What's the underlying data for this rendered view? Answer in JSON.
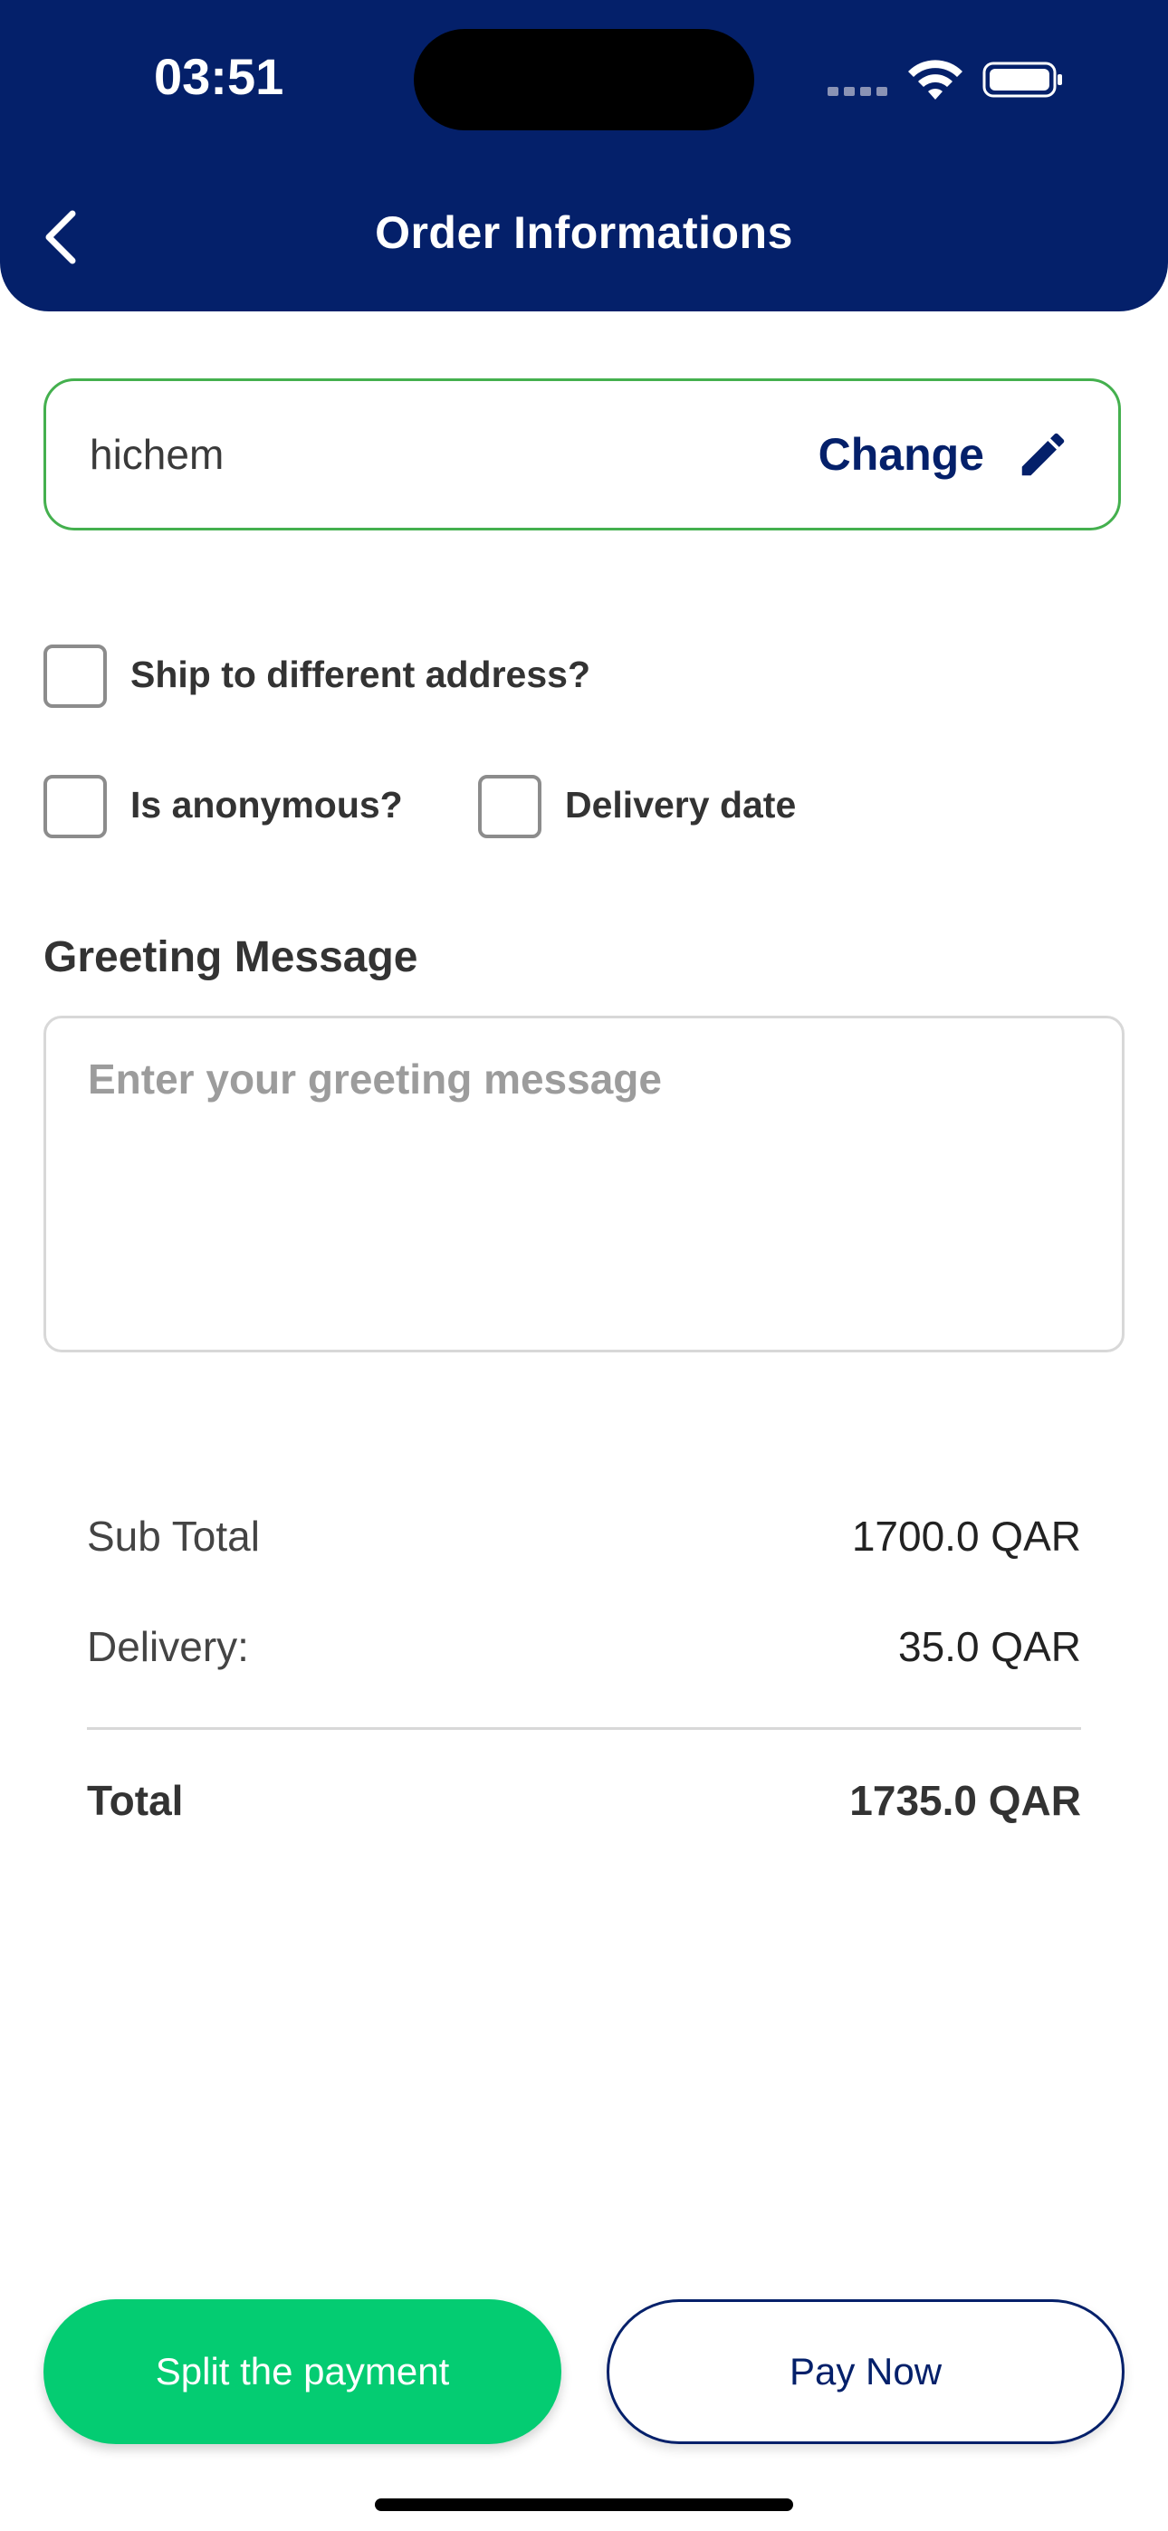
{
  "status_bar": {
    "time": "03:51"
  },
  "header": {
    "title": "Order Informations",
    "icons": {
      "back": "chevron-left-icon"
    }
  },
  "recipient": {
    "name": "hichem",
    "change_label": "Change",
    "icon": "pencil-icon",
    "border_color": "#44b04e"
  },
  "options": {
    "ship_different": {
      "label": "Ship to different address?",
      "checked": false
    },
    "anonymous": {
      "label": "Is anonymous?",
      "checked": false
    },
    "delivery_date": {
      "label": "Delivery date",
      "checked": false
    }
  },
  "greeting": {
    "title": "Greeting Message",
    "placeholder": "Enter your greeting message",
    "value": ""
  },
  "summary": {
    "subtotal_label": "Sub Total",
    "subtotal_value": "1700.0 QAR",
    "delivery_label": "Delivery:",
    "delivery_value": "35.0 QAR",
    "total_label": "Total",
    "total_value": "1735.0 QAR"
  },
  "actions": {
    "split_label": "Split the payment",
    "pay_label": "Pay Now"
  },
  "colors": {
    "header": "#04206a",
    "primary": "#04206a",
    "green_button": "#04cc72"
  }
}
